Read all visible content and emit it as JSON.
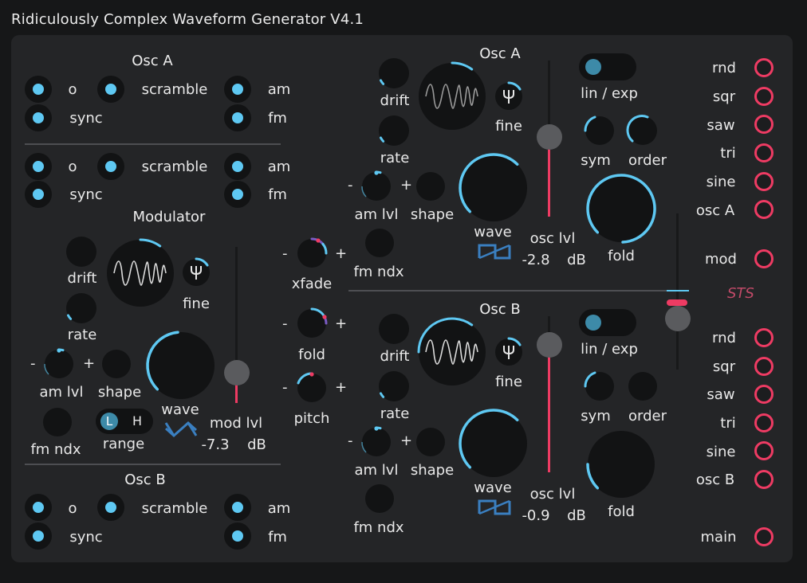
{
  "app": {
    "title": "Ridiculously Complex Waveform Generator V4.1"
  },
  "colors": {
    "accent": "#5ec8f2",
    "jack": "#ee3b63",
    "panel": "#242527"
  },
  "left": {
    "osc_a_header": "Osc A",
    "osc_b_header": "Osc B",
    "toggles_a": {
      "o": "o",
      "scramble": "scramble",
      "am": "am",
      "sync": "sync",
      "fm": "fm"
    },
    "toggles_mid": {
      "o": "o",
      "scramble": "scramble",
      "am": "am",
      "sync": "sync",
      "fm": "fm"
    },
    "toggles_b": {
      "o": "o",
      "scramble": "scramble",
      "am": "am",
      "sync": "sync",
      "fm": "fm"
    }
  },
  "modulator": {
    "header": "Modulator",
    "drift": "drift",
    "rate": "rate",
    "fine": "fine",
    "am_lvl": "am lvl",
    "shape": "shape",
    "wave": "wave",
    "fm_ndx": "fm ndx",
    "range": "range",
    "range_low": "L",
    "range_high": "H",
    "level_label": "mod lvl",
    "level_value": "-7.3",
    "level_unit": "dB",
    "minus": "-",
    "plus": "+"
  },
  "mixer": {
    "xfade": "xfade",
    "fold": "fold",
    "pitch": "pitch",
    "minus": "-",
    "plus": "+"
  },
  "osc_a": {
    "header": "Osc A",
    "drift": "drift",
    "rate": "rate",
    "fine": "fine",
    "am_lvl": "am lvl",
    "shape": "shape",
    "wave": "wave",
    "fm_ndx": "fm ndx",
    "lin_exp": "lin / exp",
    "sym": "sym",
    "order": "order",
    "fold": "fold",
    "level_label": "osc lvl",
    "level_value": "-2.8",
    "level_unit": "dB",
    "minus": "-",
    "plus": "+"
  },
  "osc_b": {
    "header": "Osc B",
    "drift": "drift",
    "rate": "rate",
    "fine": "fine",
    "am_lvl": "am lvl",
    "shape": "shape",
    "wave": "wave",
    "fm_ndx": "fm ndx",
    "lin_exp": "lin / exp",
    "sym": "sym",
    "order": "order",
    "fold": "fold",
    "level_label": "osc lvl",
    "level_value": "-0.9",
    "level_unit": "dB",
    "minus": "-",
    "plus": "+"
  },
  "outputs_a": [
    "rnd",
    "sqr",
    "saw",
    "tri",
    "sine",
    "osc A"
  ],
  "outputs_mod": "mod",
  "outputs_b": [
    "rnd",
    "sqr",
    "saw",
    "tri",
    "sine",
    "osc B"
  ],
  "outputs_main": "main",
  "logo": "STS"
}
